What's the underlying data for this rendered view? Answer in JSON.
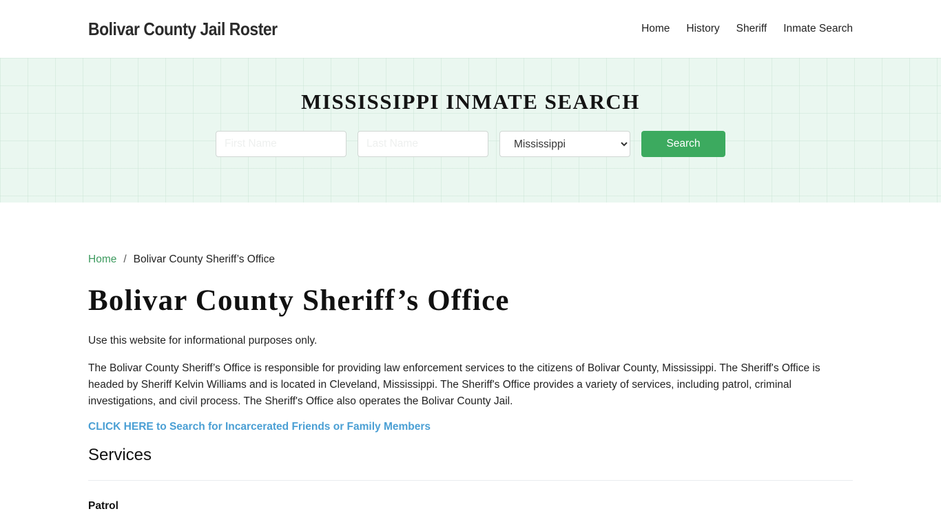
{
  "header": {
    "brand": "Bolivar County Jail Roster",
    "nav": [
      "Home",
      "History",
      "Sheriff",
      "Inmate Search"
    ]
  },
  "hero": {
    "title": "MISSISSIPPI INMATE SEARCH",
    "first_name_placeholder": "First Name",
    "last_name_placeholder": "Last Name",
    "state_selected": "Mississippi",
    "search_label": "Search"
  },
  "breadcrumb": {
    "home": "Home",
    "separator": "/",
    "current": "Bolivar County Sheriff’s Office"
  },
  "main": {
    "title": "Bolivar County Sheriff’s Office",
    "disclaimer": "Use this website for informational purposes only.",
    "description": "The Bolivar County Sheriff’s Office is responsible for providing law enforcement services to the citizens of Bolivar County, Mississippi. The Sheriff's Office is headed by Sheriff Kelvin Williams and is located in Cleveland, Mississippi. The Sheriff's Office provides a variety of services, including patrol, criminal investigations, and civil process. The Sheriff's Office also operates the Bolivar County Jail.",
    "cta": "CLICK HERE to Search for Incarcerated Friends or Family Members",
    "services_heading": "Services",
    "first_service": "Patrol"
  },
  "colors": {
    "accent_green": "#3caa5f",
    "link_blue": "#4a9fd4",
    "breadcrumb_green": "#3c9a5e",
    "hero_bg": "#eaf7f0"
  }
}
